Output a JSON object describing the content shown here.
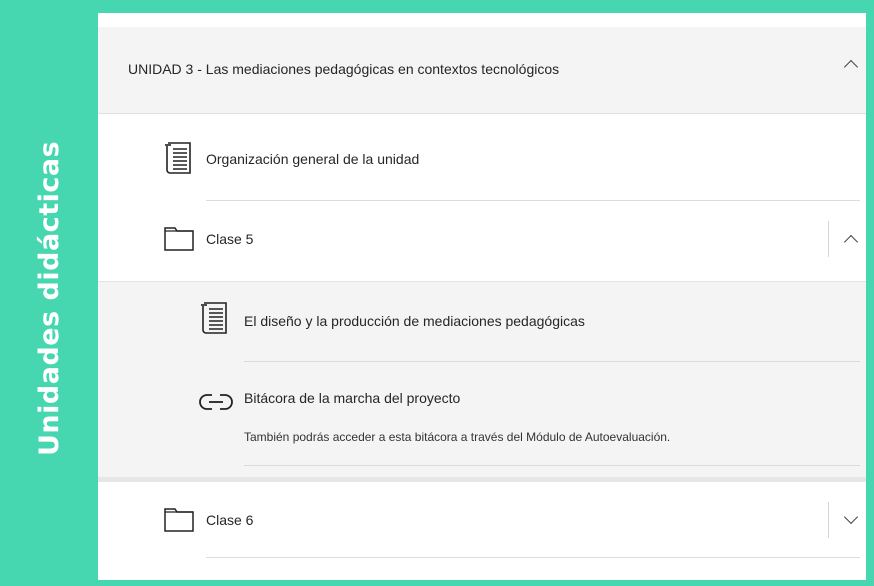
{
  "sidebar": {
    "label": "Unidades didácticas"
  },
  "unit": {
    "title": "UNIDAD 3 - Las mediaciones pedagógicas en contextos tecnológicos",
    "expanded": true
  },
  "items": {
    "organizacion": {
      "label": "Organización general de la unidad",
      "icon": "document-icon"
    },
    "clase5": {
      "label": "Clase 5",
      "icon": "folder-icon",
      "expanded": true
    },
    "diseno": {
      "label": "El diseño y la producción de mediaciones pedagógicas",
      "icon": "document-icon"
    },
    "bitacora": {
      "label": "Bitácora de la marcha del proyecto",
      "icon": "link-icon",
      "description": "También podrás acceder a esta bitácora a través del Módulo de Autoevaluación."
    },
    "clase6": {
      "label": "Clase 6",
      "icon": "folder-icon",
      "expanded": false
    }
  }
}
